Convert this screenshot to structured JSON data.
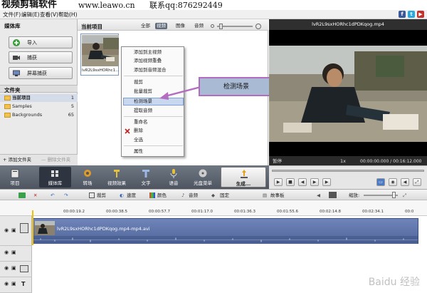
{
  "banner": {
    "title": "视频剪辑软件",
    "url": "www.leawo.cn",
    "contact": "联系qq:876292449"
  },
  "menu": {
    "file": "文件(F)",
    "edit": "编辑(E)",
    "view": "查看(V)",
    "help": "帮助(H)"
  },
  "social": {
    "fb": "f",
    "tw": "t",
    "yt": "▶"
  },
  "library": {
    "title": "媒体库",
    "buttons": [
      {
        "label": "导入"
      },
      {
        "label": "捕获"
      },
      {
        "label": "屏幕捕获"
      }
    ],
    "folders_title": "文件夹",
    "folders": [
      {
        "name": "当前项目",
        "count": "1"
      },
      {
        "name": "Samples",
        "count": "5"
      },
      {
        "name": "Backgrounds",
        "count": "65"
      }
    ],
    "add_folder": "+ 添加文件夹",
    "delete_folder": "— 删除文件夹"
  },
  "media": {
    "title": "当前项目",
    "filters": [
      "全部",
      "视频",
      "图像",
      "音频"
    ],
    "active_filter": "视频",
    "thumb_label": "lvR2L9sxHORhc1..."
  },
  "context_menu": {
    "items": [
      "添加到主视频",
      "添加视频重叠",
      "添加到音频混合",
      "裁剪",
      "批量裁剪",
      "检测场景",
      "提取音频",
      "重命名",
      "删除",
      "全选",
      "属性"
    ],
    "highlighted": "检测场景"
  },
  "callout": {
    "text": "检测场景"
  },
  "preview": {
    "title": "lvR2L9sxHORhc1dPDKqog.mp4",
    "status": "暂停",
    "speed": "1x",
    "time": "00:00:00.000 / 00:16:12.000"
  },
  "toolbar": {
    "items": [
      "项目",
      "媒体库",
      "转场",
      "视频效果",
      "文字",
      "语音",
      "光盘菜单",
      "生成..."
    ]
  },
  "timeline": {
    "tools": [
      "裁剪",
      "速度",
      "颜色",
      "音频",
      "固定",
      "故事板",
      "缩放:"
    ],
    "ticks": [
      "00:00:19.2",
      "00:00:38.5",
      "00:00:57.7",
      "00:01:17.0",
      "00:01:36.3",
      "00:01:55.6",
      "00:02:14.8",
      "00:02:34.1",
      "00:0"
    ],
    "clip_name": "lvR2L9sxHORhc1dPDKqog.mp4-mp4.avi"
  },
  "watermark": "Baidu 经验",
  "colors": {
    "toolbar_dark": "#535a66",
    "clip_blue": "#5a6fa6",
    "callout_border": "#b36cbf",
    "callout_fill": "#a9bbd4",
    "playhead": "#f2c200"
  }
}
